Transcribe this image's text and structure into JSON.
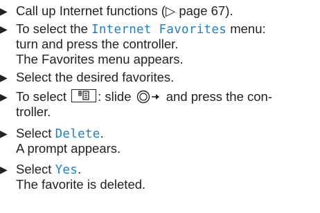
{
  "steps": [
    {
      "text_1": "Call up Internet functions (",
      "page_ref": "page 67",
      "text_2": ")."
    },
    {
      "line1_pre": "To select the ",
      "line1_ui": "Internet Favorites",
      "line1_post": " menu:",
      "line2": "turn and press the controller.",
      "line3": "The Favorites menu appears."
    },
    {
      "line1": "Select the desired favorites."
    },
    {
      "line1_pre": "To select ",
      "line1_mid": ": slide ",
      "line1_post": " and press the con-",
      "line2": "troller."
    },
    {
      "line1_pre": "Select ",
      "line1_ui": "Delete",
      "line1_post": ".",
      "line2": "A prompt appears."
    },
    {
      "line1_pre": "Select ",
      "line1_ui": "Yes",
      "line1_post": ".",
      "line2": "The favorite is deleted."
    }
  ],
  "icons": {
    "bullet": "triangle-right-icon",
    "page_ref": "triangle-outline-icon",
    "menu_button": "menu-list-icon",
    "controller": "controller-slide-right-icon"
  },
  "colors": {
    "text": "#222222",
    "ui_label": "#1e7fc6"
  }
}
